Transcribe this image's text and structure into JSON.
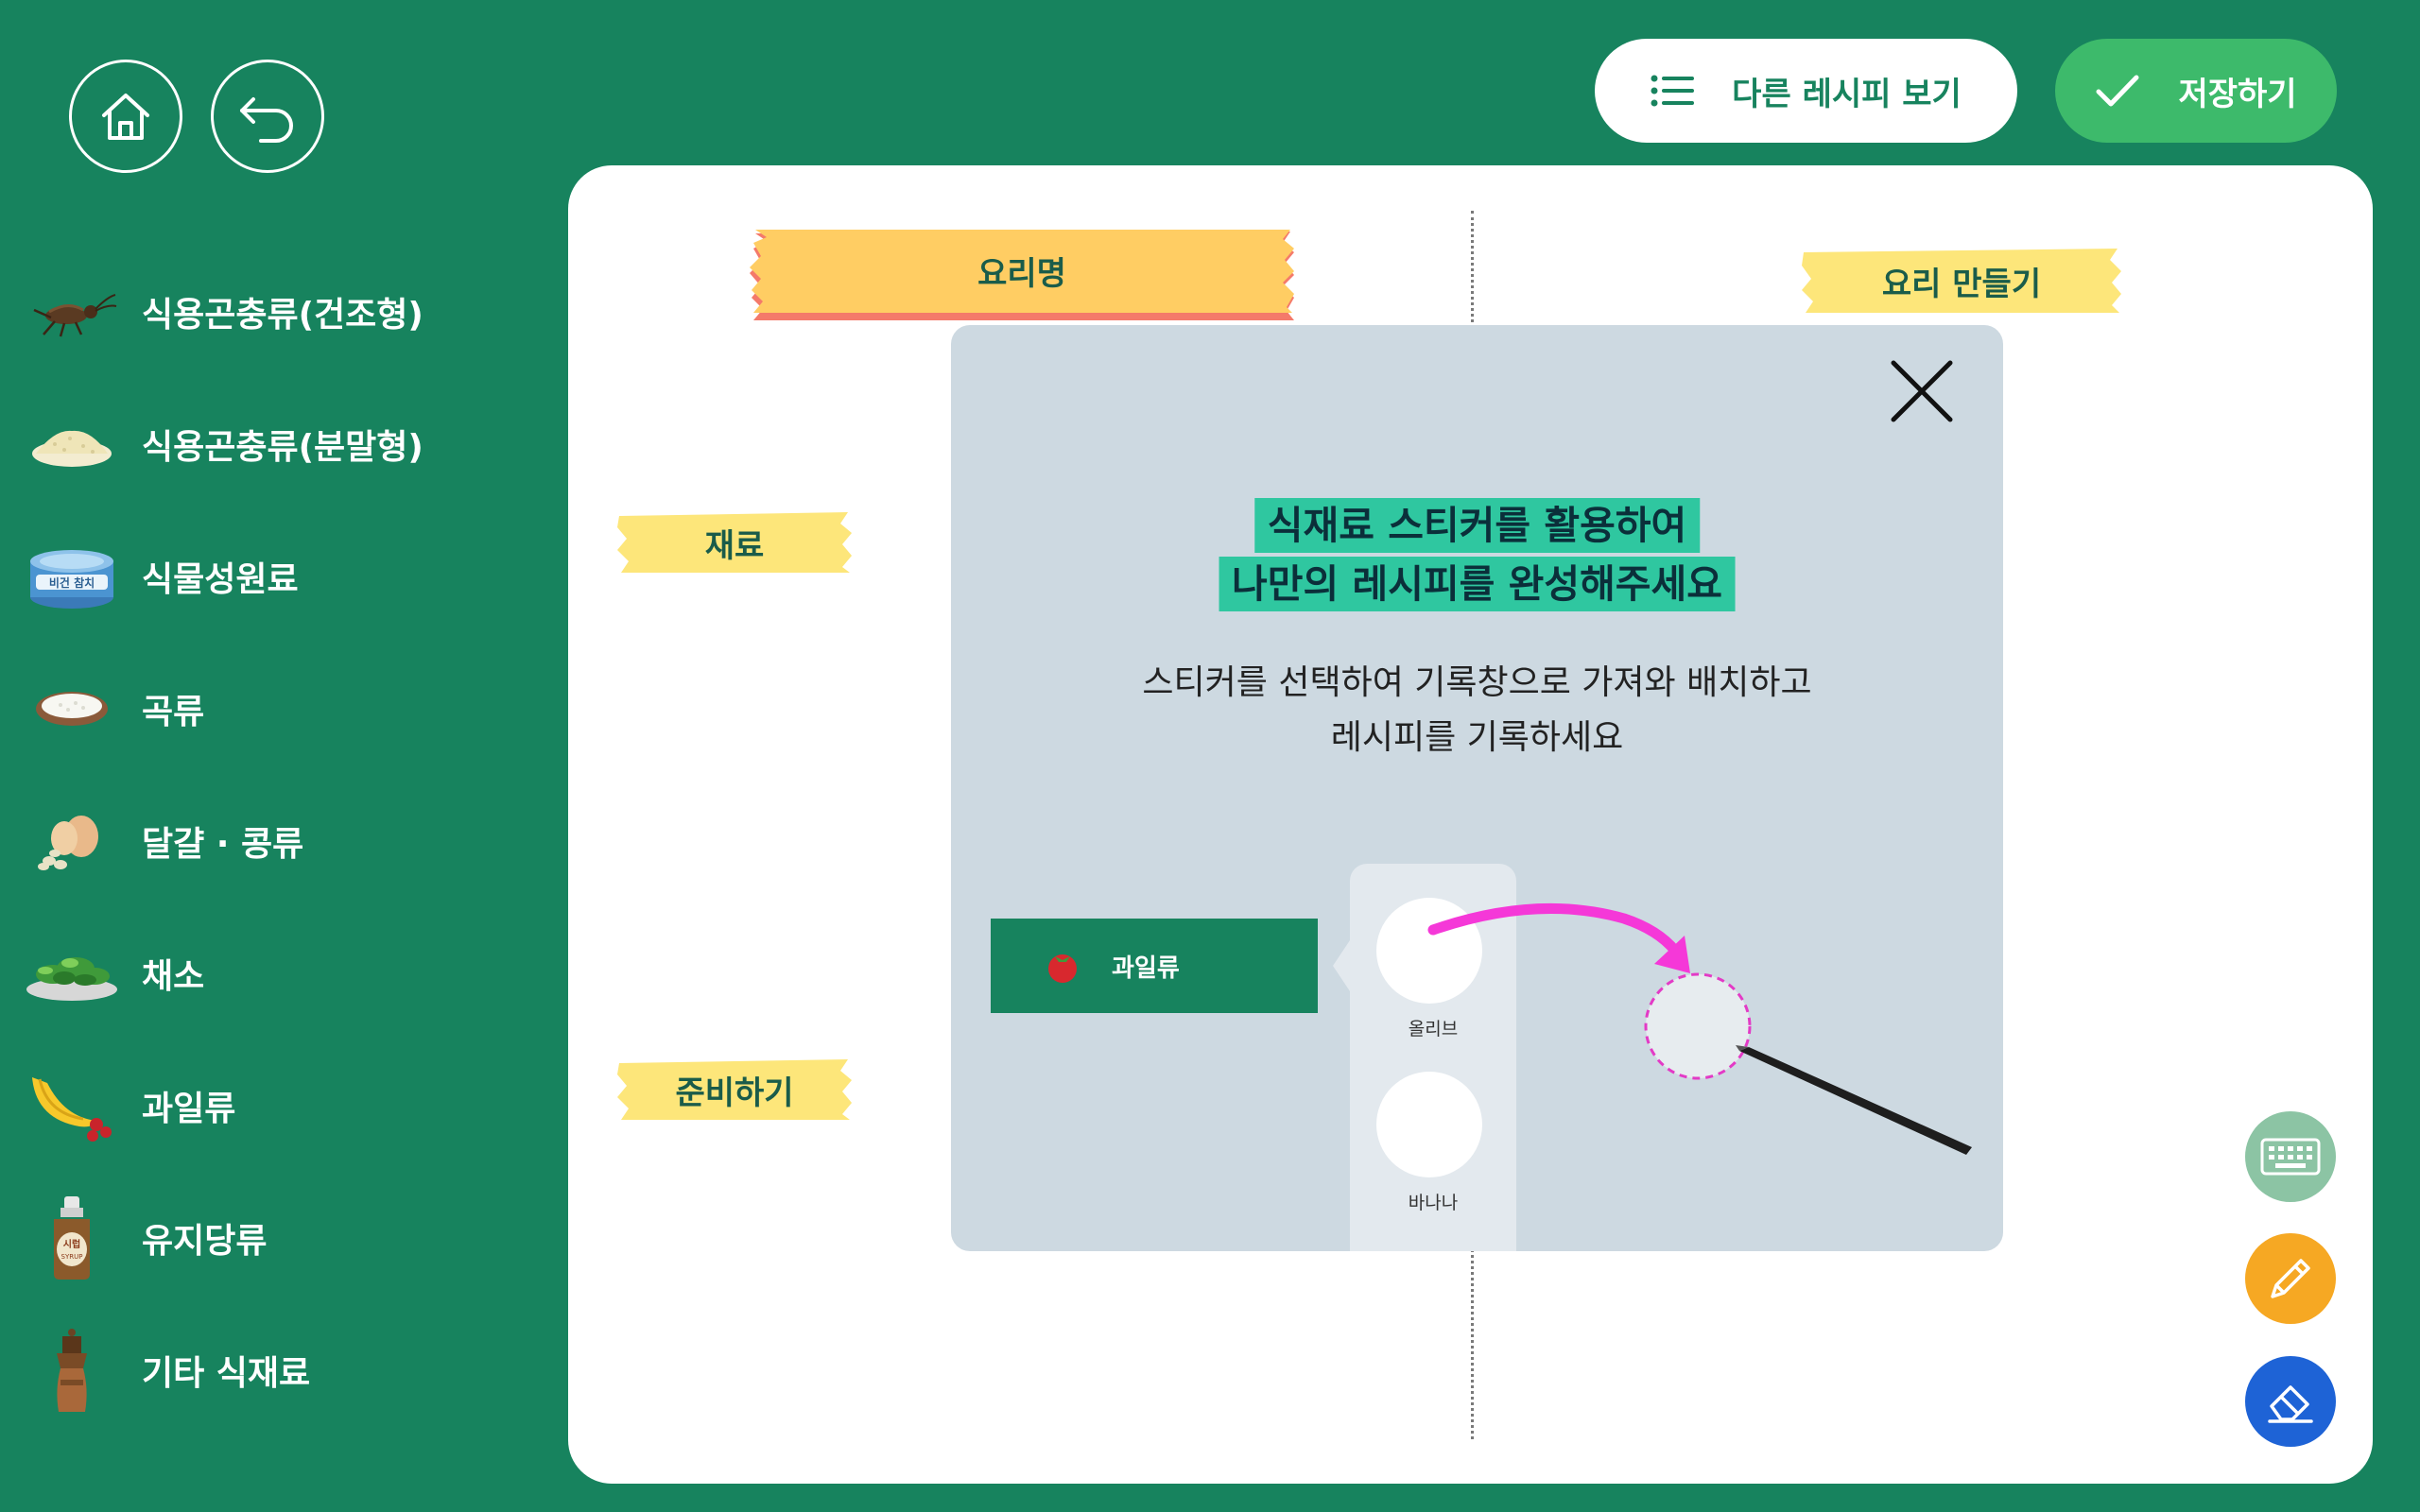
{
  "nav": {
    "home_icon": "home-icon",
    "back_icon": "back-arrow-icon"
  },
  "header": {
    "other_recipes_label": "다른 레시피 보기",
    "other_recipes_icon": "list-icon",
    "save_label": "저장하기",
    "save_icon": "check-icon"
  },
  "sidebar": {
    "items": [
      {
        "label": "식용곤충류(건조형)",
        "icon": "cricket-icon"
      },
      {
        "label": "식용곤충류(분말형)",
        "icon": "powder-icon"
      },
      {
        "label": "식물성원료",
        "icon": "vegan-tuna-can-icon",
        "icon_text": "비건 참치"
      },
      {
        "label": "곡류",
        "icon": "rice-bowl-icon"
      },
      {
        "label": "달걀 · 콩류",
        "icon": "eggs-beans-icon"
      },
      {
        "label": "채소",
        "icon": "salad-icon"
      },
      {
        "label": "과일류",
        "icon": "banana-icon"
      },
      {
        "label": "유지당류",
        "icon": "syrup-bottle-icon",
        "icon_text": "시럽 SYRUP"
      },
      {
        "label": "기타 식재료",
        "icon": "pepper-grinder-icon"
      }
    ]
  },
  "board": {
    "dish_name_label": "요리명",
    "ingredients_label": "재료",
    "prepare_label": "준비하기",
    "cooking_label": "요리 만들기"
  },
  "modal": {
    "title_line1": "식재료 스티커를 활용하여",
    "title_line2": "나만의 레시피를 완성해주세요",
    "desc_line1": "스티커를 선택하여 기록창으로 가져와 배치하고",
    "desc_line2": "레시피를 기록하세요",
    "close_icon": "close-icon",
    "demo": {
      "category_label": "과일류",
      "category_icon": "tomato-icon",
      "items": [
        "올리브",
        "바나나"
      ],
      "arrow_icon": "drag-arrow-icon",
      "pen_icon": "stylus-pen-icon"
    }
  },
  "tools": [
    {
      "name": "keyboard-icon",
      "color": "#8cc4a4"
    },
    {
      "name": "pencil-icon",
      "color": "#f6a823"
    },
    {
      "name": "eraser-icon",
      "color": "#1e63d6"
    }
  ],
  "colors": {
    "background": "#17835e",
    "save_button": "#3dba6b",
    "title_highlight": "#2fc7a0",
    "modal_bg": "#cdd9e1",
    "tape_orange": "#ffcd63",
    "tape_yellow": "#fde67a",
    "arrow_magenta": "#f538d8"
  }
}
